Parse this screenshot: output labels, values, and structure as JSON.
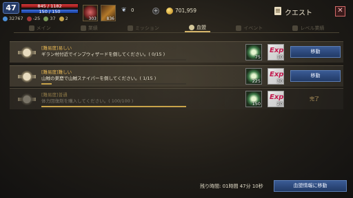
{
  "hud": {
    "level": "47",
    "hp": "845 / 1182",
    "mp": "150 / 150",
    "stats": [
      "32767",
      "-25",
      "37",
      "2"
    ],
    "slot1_count": "303",
    "slot2_count": "836",
    "wings": "0",
    "gold": "701,959",
    "plus": "+"
  },
  "header": {
    "title": "クエスト",
    "close": "✕"
  },
  "tabs": [
    {
      "label": "メイン",
      "active": false
    },
    {
      "label": "業績",
      "active": false
    },
    {
      "label": "ミッション",
      "active": false
    },
    {
      "label": "血盟",
      "active": true
    },
    {
      "label": "イベント",
      "active": false
    },
    {
      "label": "レベル業績",
      "active": false
    }
  ],
  "quests": [
    {
      "name": "[難易度]易しい",
      "desc": "ギラン村付近でインプウィザードを倒してください。( 0/15 )",
      "progress": 0,
      "rewards": [
        "75",
        "10"
      ],
      "action": "移動"
    },
    {
      "name": "[難易度]難しい",
      "desc": "山賊の巣窟で山賊スナイパーを倒してください。( 1/15 )",
      "progress": 0.07,
      "rewards": [
        "225",
        "30"
      ],
      "action": "移動"
    },
    {
      "name": "[難易度]普通",
      "desc": "体力回復剤を購入してください。( 100/100 )",
      "progress": 1,
      "rewards": [
        "150",
        "20"
      ],
      "action": "完了"
    }
  ],
  "footer": {
    "remaining": "残り時間: 01時間 47分 10秒",
    "info_button": "血盟情報に移動"
  },
  "colors": {
    "accent": "#d4b46a",
    "button": "#2b4a80",
    "name": "#e6b654"
  }
}
